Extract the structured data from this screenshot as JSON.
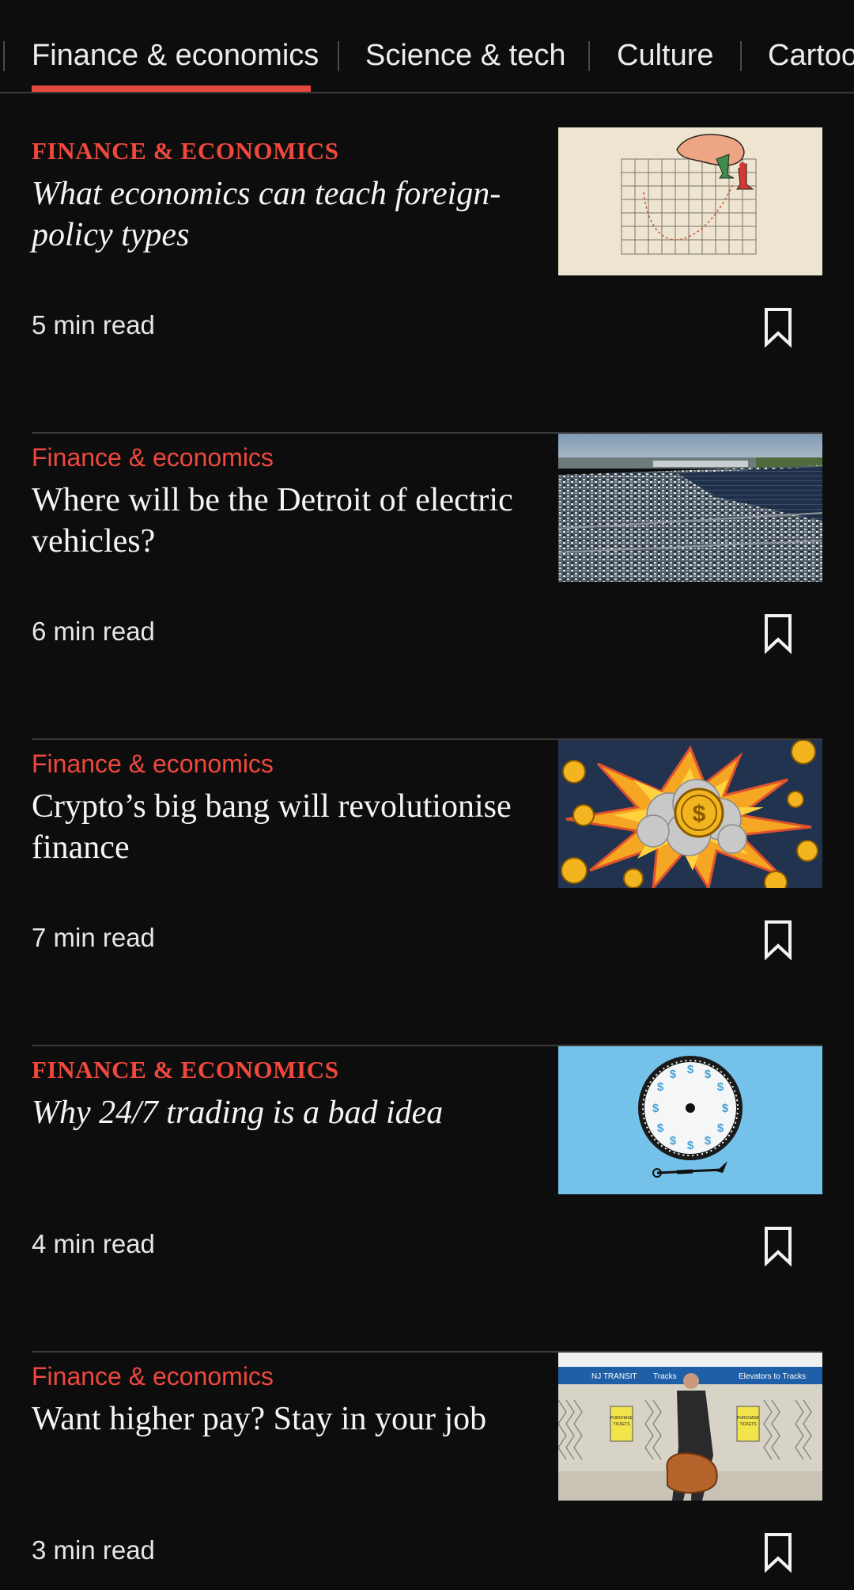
{
  "tabs": [
    {
      "label": "Finance & economics",
      "active": true
    },
    {
      "label": "Science & tech",
      "active": false
    },
    {
      "label": "Culture",
      "active": false
    },
    {
      "label": "Cartoo",
      "active": false
    }
  ],
  "colors": {
    "background": "#0d0d0d",
    "accent": "#e3473f",
    "kicker": "#f0483d",
    "divider": "#3a3a3a",
    "text": "#f5f5f5"
  },
  "articles": [
    {
      "kicker": "FINANCE & ECONOMICS",
      "kicker_style": "serif-caps",
      "headline": "What economics can teach foreign-policy types",
      "headline_style": "italic",
      "read_time": "5 min read",
      "image": "chess-hand-chart-illustration",
      "bookmark_icon": "bookmark-icon"
    },
    {
      "kicker": "Finance & economics",
      "kicker_style": "sans",
      "headline": "Where will be the Detroit of electric vehicles?",
      "headline_style": "roman",
      "read_time": "6 min read",
      "image": "car-lot-aerial-photo",
      "bookmark_icon": "bookmark-icon"
    },
    {
      "kicker": "Finance & economics",
      "kicker_style": "sans",
      "headline": "Crypto’s big bang will revolutionise finance",
      "headline_style": "roman",
      "read_time": "7 min read",
      "image": "coin-explosion-illustration",
      "bookmark_icon": "bookmark-icon"
    },
    {
      "kicker": "FINANCE & ECONOMICS",
      "kicker_style": "serif-caps",
      "headline": "Why 24/7 trading is a bad idea",
      "headline_style": "italic",
      "read_time": "4 min read",
      "image": "dollar-clock-illustration",
      "bookmark_icon": "bookmark-icon"
    },
    {
      "kicker": "Finance & economics",
      "kicker_style": "sans",
      "headline": "Want higher pay? Stay in your job",
      "headline_style": "roman",
      "read_time": "3 min read",
      "image": "commuter-station-photo",
      "image_text": {
        "sign_left": "NJ TRANSIT",
        "sign_mid": "Tracks",
        "sign_right": "Elevators to Tracks",
        "poster": "PURCHASE TICKETS"
      },
      "bookmark_icon": "bookmark-icon"
    }
  ]
}
